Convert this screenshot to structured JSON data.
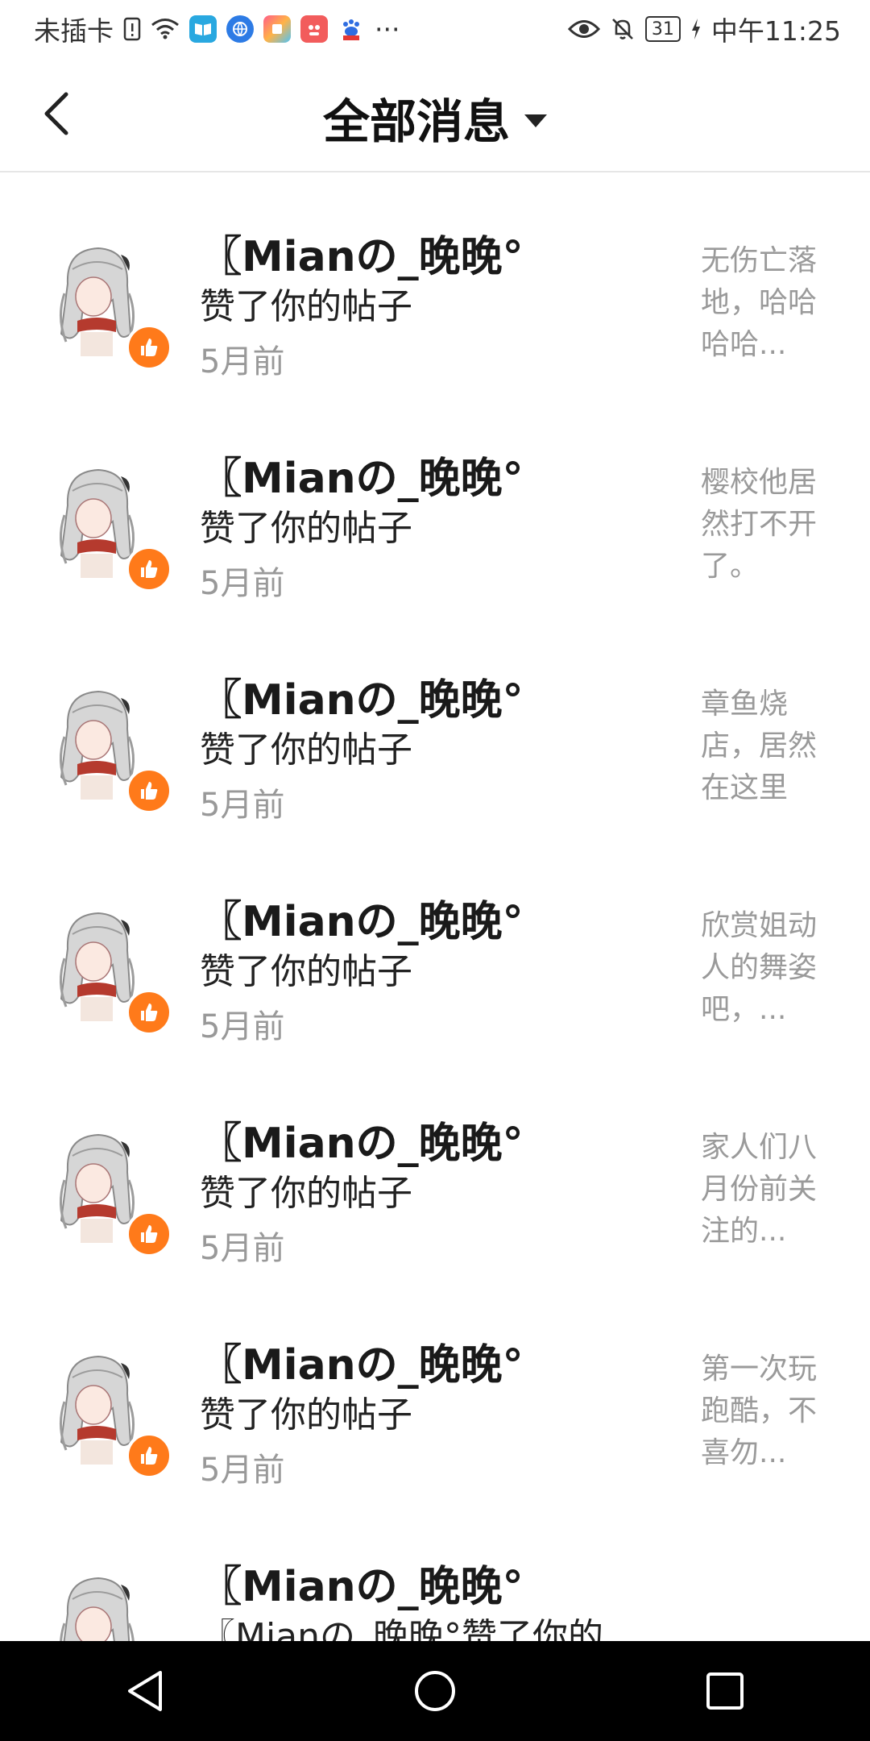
{
  "status_bar": {
    "carrier": "未插卡",
    "more": "···",
    "battery": "31",
    "time": "中午11:25"
  },
  "header": {
    "title": "全部消息"
  },
  "messages": [
    {
      "user": "〖Mianの_晚晚°",
      "action": "赞了你的帖子",
      "time": "5月前",
      "preview": "无伤亡落地，哈哈哈哈..."
    },
    {
      "user": "〖Mianの_晚晚°",
      "action": "赞了你的帖子",
      "time": "5月前",
      "preview": "樱校他居然打不开了。"
    },
    {
      "user": "〖Mianの_晚晚°",
      "action": "赞了你的帖子",
      "time": "5月前",
      "preview": "章鱼烧店，居然在这里"
    },
    {
      "user": "〖Mianの_晚晚°",
      "action": "赞了你的帖子",
      "time": "5月前",
      "preview": "欣赏姐动人的舞姿吧，..."
    },
    {
      "user": "〖Mianの_晚晚°",
      "action": "赞了你的帖子",
      "time": "5月前",
      "preview": "家人们八月份前关注的..."
    },
    {
      "user": "〖Mianの_晚晚°",
      "action": "赞了你的帖子",
      "time": "5月前",
      "preview": "第一次玩跑酷，不喜勿..."
    },
    {
      "user": "〖Mianの_晚晚°",
      "action": "〖Mianの_晚晚°赞了你的",
      "time": "",
      "preview": ""
    }
  ],
  "colors": {
    "accent_like": "#ff7a1a",
    "secondary_text": "#999999"
  },
  "icons": {
    "back": "chevron-left-icon",
    "dropdown": "caret-down-icon",
    "like": "thumbs-up-icon"
  }
}
